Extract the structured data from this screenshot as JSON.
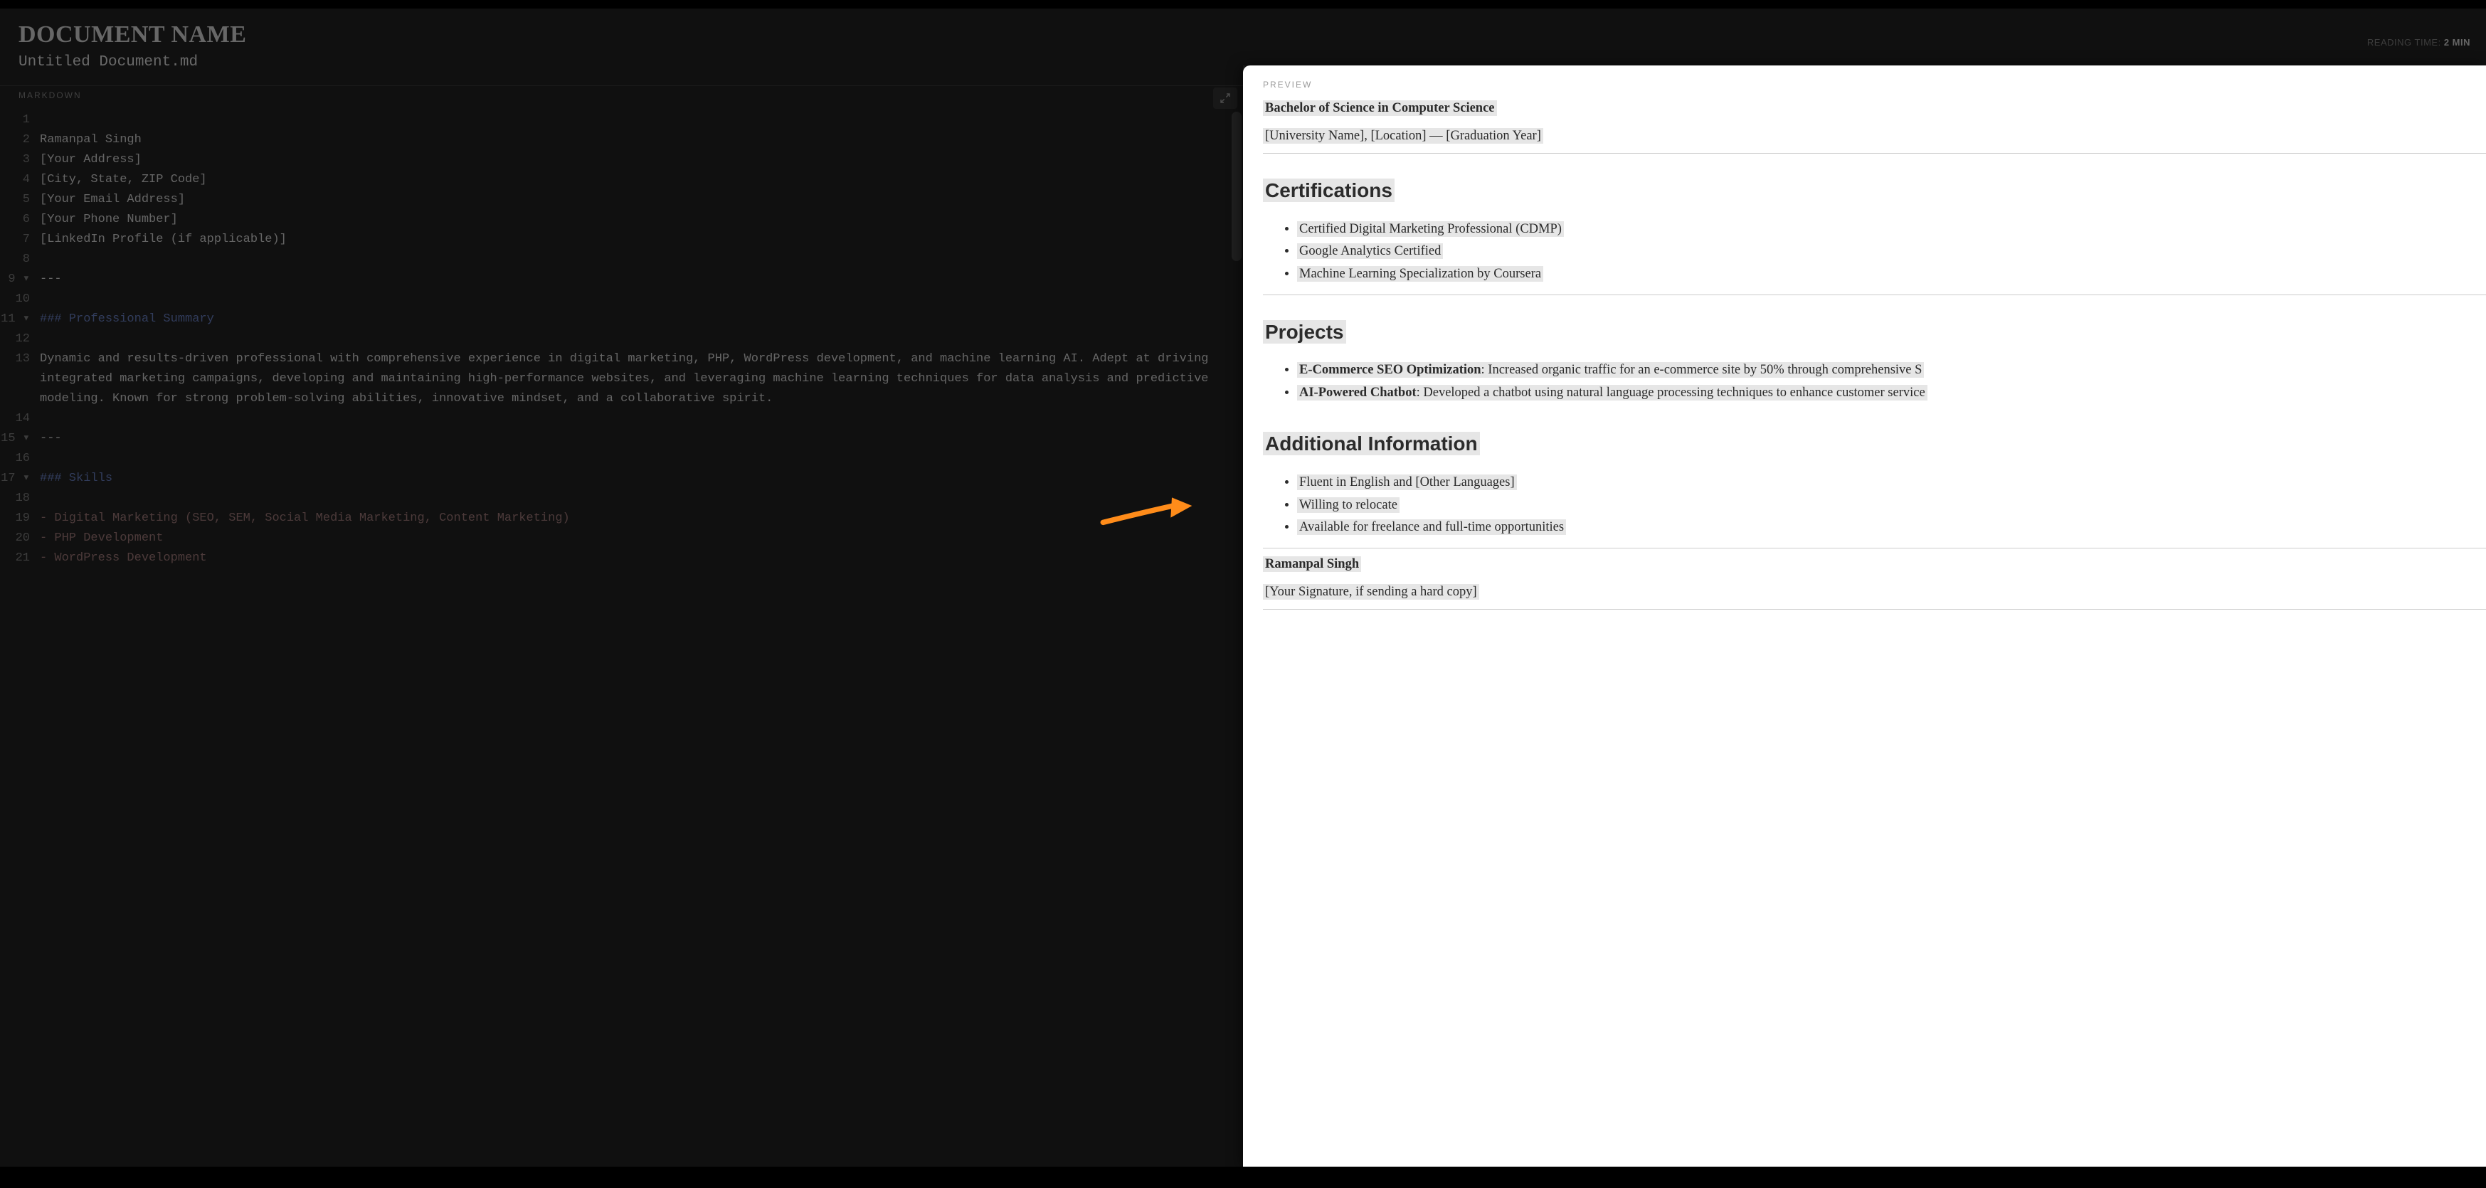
{
  "header": {
    "doc_label": "DOCUMENT NAME",
    "filename": "Untitled Document.md",
    "reading_time_label": "READING TIME:",
    "reading_time_value": "2 MIN"
  },
  "panes": {
    "editor_caption": "MARKDOWN",
    "preview_caption": "PREVIEW"
  },
  "editor": {
    "lines": [
      {
        "n": "1",
        "fold": "",
        "cls": "",
        "text": ""
      },
      {
        "n": "2",
        "fold": "",
        "cls": "",
        "text": "Ramanpal Singh"
      },
      {
        "n": "3",
        "fold": "",
        "cls": "",
        "text": "[Your Address]"
      },
      {
        "n": "4",
        "fold": "",
        "cls": "",
        "text": "[City, State, ZIP Code]"
      },
      {
        "n": "5",
        "fold": "",
        "cls": "",
        "text": "[Your Email Address]"
      },
      {
        "n": "6",
        "fold": "",
        "cls": "",
        "text": "[Your Phone Number]"
      },
      {
        "n": "7",
        "fold": "",
        "cls": "",
        "text": "[LinkedIn Profile (if applicable)]"
      },
      {
        "n": "8",
        "fold": "",
        "cls": "",
        "text": ""
      },
      {
        "n": "9",
        "fold": "▾",
        "cls": "",
        "text": "---"
      },
      {
        "n": "10",
        "fold": "",
        "cls": "",
        "text": ""
      },
      {
        "n": "11",
        "fold": "▾",
        "cls": "tok-heading",
        "text": "### Professional Summary"
      },
      {
        "n": "12",
        "fold": "",
        "cls": "",
        "text": ""
      },
      {
        "n": "13",
        "fold": "",
        "cls": "",
        "text": "Dynamic and results-driven professional with comprehensive experience in digital marketing, PHP, WordPress development, and machine learning AI. Adept at driving integrated marketing campaigns, developing and maintaining high-performance websites, and leveraging machine learning techniques for data analysis and predictive modeling. Known for strong problem-solving abilities, innovative mindset, and a collaborative spirit."
      },
      {
        "n": "14",
        "fold": "",
        "cls": "",
        "text": ""
      },
      {
        "n": "15",
        "fold": "▾",
        "cls": "",
        "text": "---"
      },
      {
        "n": "16",
        "fold": "",
        "cls": "",
        "text": ""
      },
      {
        "n": "17",
        "fold": "▾",
        "cls": "tok-heading",
        "text": "### Skills"
      },
      {
        "n": "18",
        "fold": "",
        "cls": "",
        "text": ""
      },
      {
        "n": "19",
        "fold": "",
        "cls": "tok-list",
        "text": "- Digital Marketing (SEO, SEM, Social Media Marketing, Content Marketing)"
      },
      {
        "n": "20",
        "fold": "",
        "cls": "tok-list",
        "text": "- PHP Development"
      },
      {
        "n": "21",
        "fold": "",
        "cls": "tok-list",
        "text": "- WordPress Development"
      }
    ]
  },
  "preview": {
    "degree": "Bachelor of Science in Computer Science",
    "degree_sub": "[University Name], [Location] — [Graduation Year]",
    "h_cert": "Certifications",
    "certs": [
      "Certified Digital Marketing Professional (CDMP)",
      "Google Analytics Certified",
      "Machine Learning Specialization by Coursera"
    ],
    "h_proj": "Projects",
    "proj1_b": "E-Commerce SEO Optimization",
    "proj1_t": ": Increased organic traffic for an e-commerce site by 50% through comprehensive S",
    "proj2_b": "AI-Powered Chatbot",
    "proj2_t": ": Developed a chatbot using natural language processing techniques to enhance customer service",
    "h_add": "Additional Information",
    "addl": [
      "Fluent in English and [Other Languages]",
      "Willing to relocate",
      "Available for freelance and full-time opportunities"
    ],
    "sig_name": "Ramanpal Singh",
    "sig_note": "[Your Signature, if sending a hard copy]"
  }
}
